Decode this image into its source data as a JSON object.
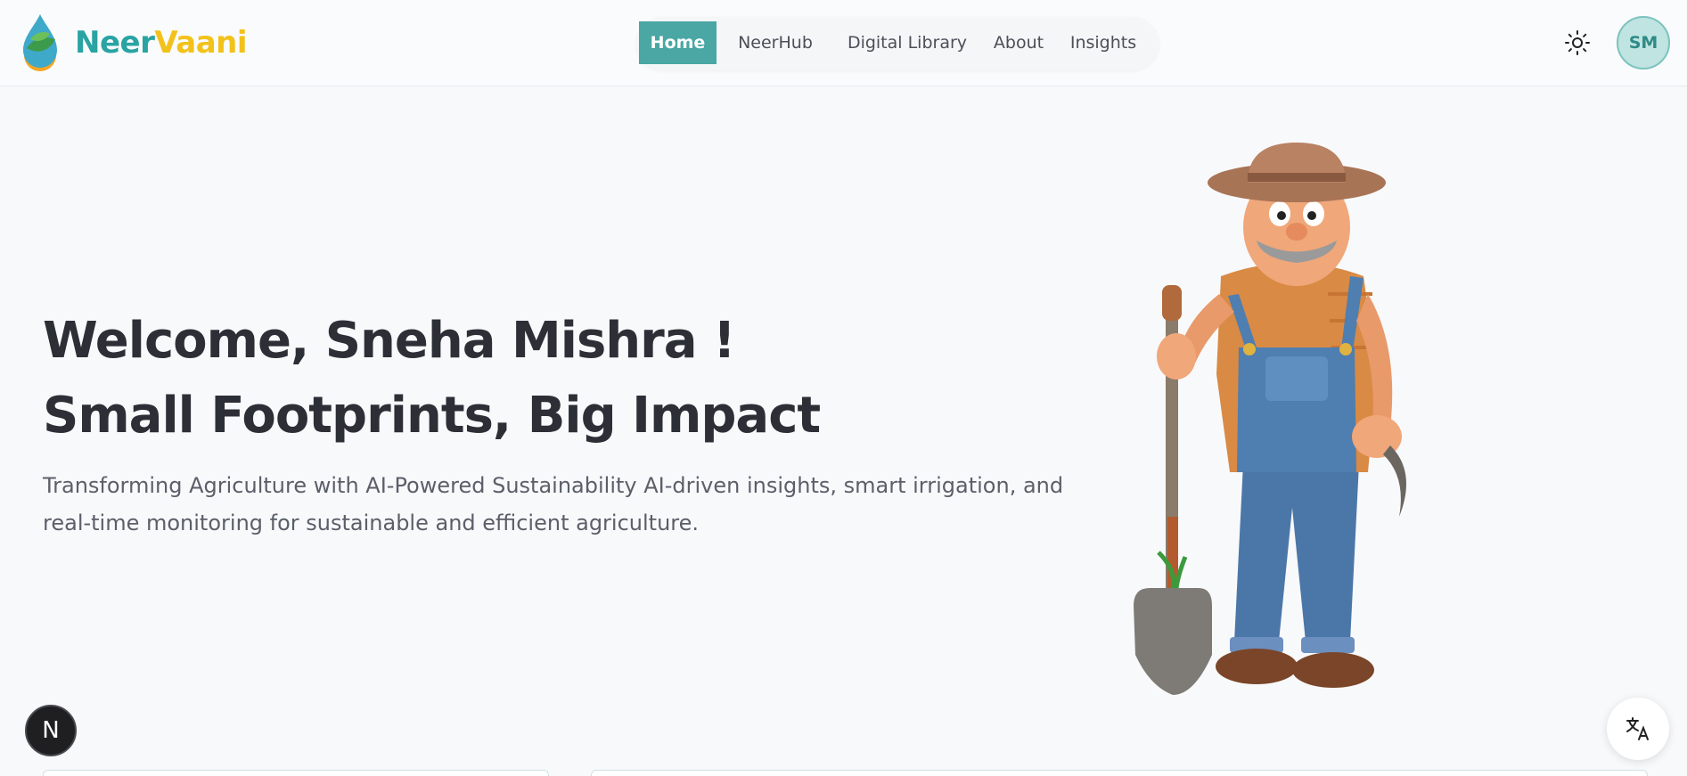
{
  "brand": {
    "name_part1": "Neer",
    "name_part2": "Vaani",
    "accent": "#2aa3a3",
    "secondary": "#f2c21a"
  },
  "nav": {
    "items": [
      {
        "label": "Home",
        "active": true
      },
      {
        "label": "NeerHub",
        "active": false
      },
      {
        "label": "Digital Library",
        "active": false
      },
      {
        "label": "About",
        "active": false
      },
      {
        "label": "Insights",
        "active": false
      }
    ]
  },
  "header": {
    "theme_icon": "sun-icon",
    "avatar_initials": "SM"
  },
  "hero": {
    "greeting": "Welcome, Sneha Mishra !",
    "tagline": "Small Footprints, Big Impact",
    "description": "Transforming Agriculture with AI-Powered Sustainability AI-driven insights, smart irrigation, and real-time monitoring for sustainable and efficient agriculture."
  },
  "floating": {
    "next_badge": "N",
    "translate_icon": "translate-icon"
  }
}
